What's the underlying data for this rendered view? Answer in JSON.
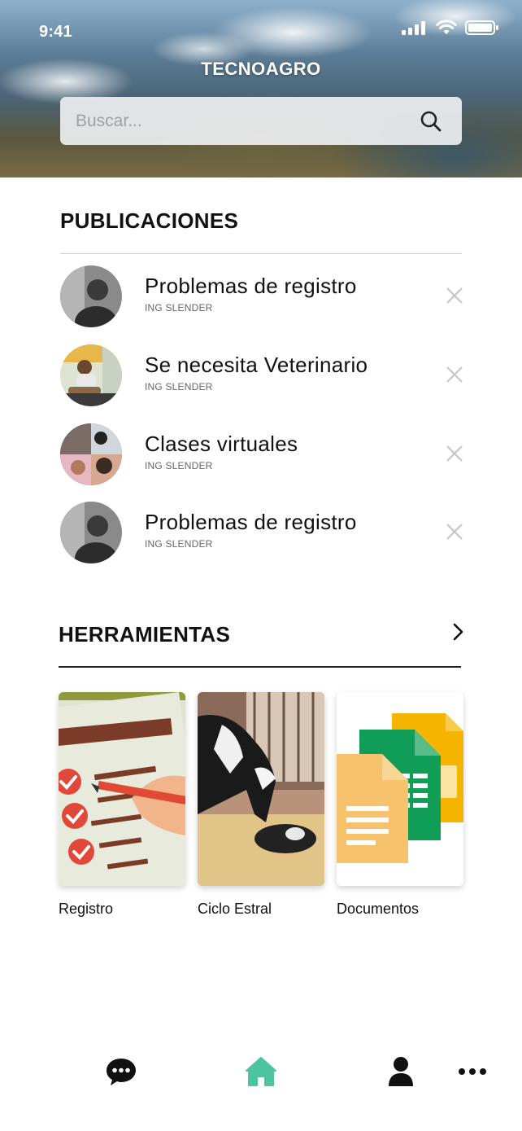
{
  "status_bar": {
    "time": "9:41"
  },
  "header": {
    "app_title": "TECNOAGRO"
  },
  "search": {
    "placeholder": "Buscar..."
  },
  "publicaciones": {
    "title": "PUBLICACIONES",
    "items": [
      {
        "title": "Problemas de registro",
        "author": "ING SLENDER"
      },
      {
        "title": "Se necesita Veterinario",
        "author": "ING SLENDER"
      },
      {
        "title": "Clases virtuales",
        "author": "ING SLENDER"
      },
      {
        "title": "Problemas de registro",
        "author": "ING SLENDER"
      }
    ]
  },
  "herramientas": {
    "title": "HERRAMIENTAS",
    "tools": [
      {
        "label": "Registro"
      },
      {
        "label": "Ciclo Estral"
      },
      {
        "label": "Documentos"
      }
    ]
  },
  "bottom_nav": {
    "items": [
      {
        "icon": "chat-icon"
      },
      {
        "icon": "home-icon",
        "active": true
      },
      {
        "icon": "user-icon"
      },
      {
        "icon": "more-icon"
      }
    ]
  },
  "colors": {
    "accent": "#4cc4a0",
    "text": "#111111"
  }
}
